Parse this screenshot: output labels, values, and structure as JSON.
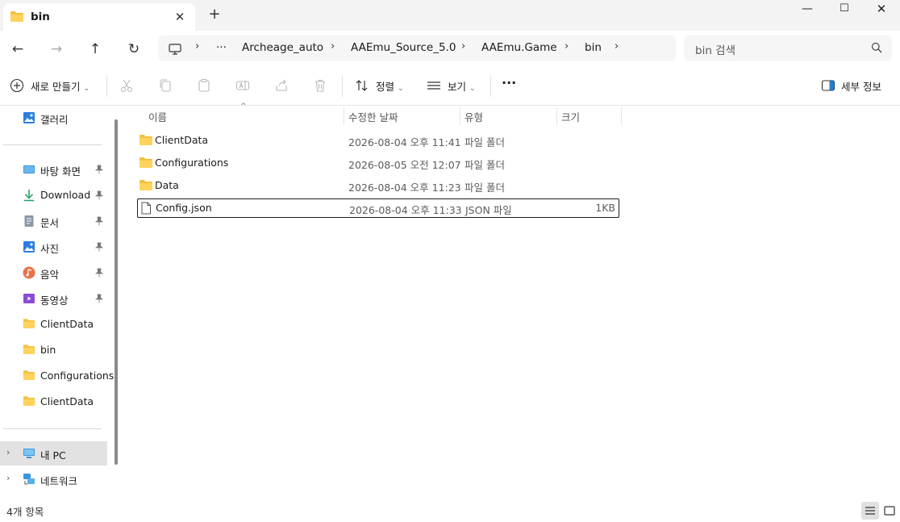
{
  "window": {
    "tab_title": "bin",
    "new_tab_label": "+",
    "minimize": "—",
    "maximize": "☐",
    "close": "✕"
  },
  "nav": {
    "back": "←",
    "forward": "→",
    "up": "↑",
    "refresh": "↻",
    "more": "···",
    "breadcrumbs": [
      "Archeage_auto",
      "AAEmu_Source_5.0",
      "AAEmu.Game",
      "bin"
    ],
    "search_placeholder": "bin 검색"
  },
  "commands": {
    "new_label": "새로 만들기",
    "sort_label": "정렬",
    "view_label": "보기",
    "more_label": "···",
    "details_label": "세부 정보"
  },
  "sidebar": {
    "gallery": "갤러리",
    "pinned": [
      {
        "label": "바탕 화면",
        "icon": "desktop-icon"
      },
      {
        "label": "Download",
        "icon": "download-icon"
      },
      {
        "label": "문서",
        "icon": "documents-icon"
      },
      {
        "label": "사진",
        "icon": "pictures-icon"
      },
      {
        "label": "음악",
        "icon": "music-icon"
      },
      {
        "label": "동영상",
        "icon": "videos-icon"
      }
    ],
    "folders": [
      "ClientData",
      "bin",
      "Configurations",
      "ClientData"
    ],
    "this_pc": "내 PC",
    "network": "네트워크"
  },
  "columns": {
    "name": "이름",
    "modified": "수정한 날짜",
    "type": "유형",
    "size": "크기"
  },
  "files": [
    {
      "name": "ClientData",
      "modified": "2026-08-04 오후 11:41",
      "type": "파일 폴더",
      "size": "",
      "kind": "folder"
    },
    {
      "name": "Configurations",
      "modified": "2026-08-05 오전 12:07",
      "type": "파일 폴더",
      "size": "",
      "kind": "folder"
    },
    {
      "name": "Data",
      "modified": "2026-08-04 오후 11:23",
      "type": "파일 폴더",
      "size": "",
      "kind": "folder"
    },
    {
      "name": "Config.json",
      "modified": "2026-08-04 오후 11:33",
      "type": "JSON 파일",
      "size": "1KB",
      "kind": "file"
    }
  ],
  "status": {
    "item_count": "4개 항목"
  },
  "colors": {
    "folder": "#f4c042",
    "accent": "#0067c0"
  }
}
